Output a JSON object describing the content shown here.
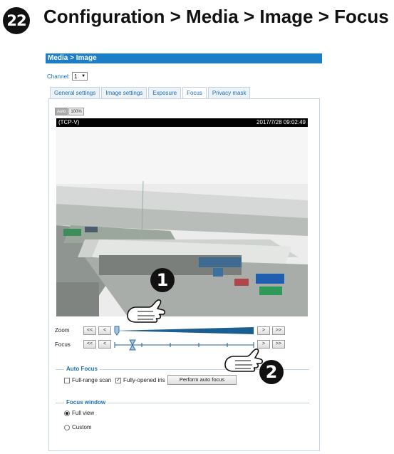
{
  "step_number": "22",
  "heading": "Configuration > Media > Image > Focus",
  "panel": {
    "title": "Media > Image",
    "channel_label": "Channel:",
    "channel_value": "1"
  },
  "tabs": [
    {
      "label": "General settings",
      "active": false
    },
    {
      "label": "Image settings",
      "active": false
    },
    {
      "label": "Exposure",
      "active": false
    },
    {
      "label": "Focus",
      "active": true
    },
    {
      "label": "Privacy mask",
      "active": false
    }
  ],
  "view_toggle": [
    "Auto",
    "100%"
  ],
  "video": {
    "stream_label": "(TCP-V)",
    "timestamp": "2017/7/28 09:02:49"
  },
  "zoom": {
    "label": "Zoom",
    "buttons": [
      "<<",
      "<",
      ">",
      ">>"
    ],
    "level": 0.0
  },
  "focus": {
    "label": "Focus",
    "buttons": [
      "<<",
      "<",
      ">",
      ">>"
    ],
    "level": 0.12
  },
  "auto_focus": {
    "legend": "Auto Focus",
    "full_range_scan": {
      "label": "Full-range scan",
      "checked": false
    },
    "fully_opened_iris": {
      "label": "Fully-opened iris",
      "checked": true
    },
    "perform_button": "Perform auto focus"
  },
  "focus_window": {
    "legend": "Focus window",
    "options": [
      {
        "label": "Full view",
        "selected": true
      },
      {
        "label": "Custom",
        "selected": false
      }
    ]
  },
  "callouts": [
    "1",
    "2"
  ],
  "colors": {
    "titlebar": "#1a7fc8",
    "tab_text": "#1a6fb0",
    "slider_fill": "#1a5f90"
  }
}
